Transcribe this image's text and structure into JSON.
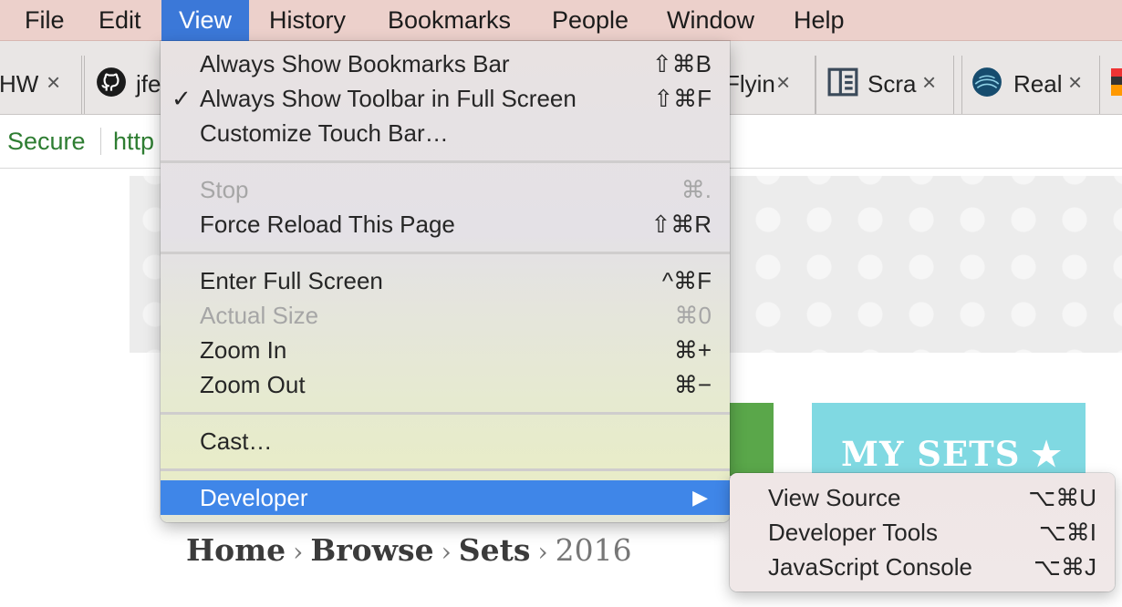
{
  "menubar": {
    "items": [
      {
        "label": "File"
      },
      {
        "label": "Edit"
      },
      {
        "label": "View"
      },
      {
        "label": "History"
      },
      {
        "label": "Bookmarks"
      },
      {
        "label": "People"
      },
      {
        "label": "Window"
      },
      {
        "label": "Help"
      }
    ],
    "active": "View"
  },
  "tabs": [
    {
      "title": "HW",
      "close": "×"
    },
    {
      "title": "jfe",
      "icon": "github-icon"
    },
    {
      "title": "Flyin",
      "close": "×"
    },
    {
      "title": "Scra",
      "close": "×",
      "icon": "book-icon"
    },
    {
      "title": "Real",
      "close": "×",
      "icon": "globe-icon"
    }
  ],
  "address": {
    "secure": "Secure",
    "url": "http"
  },
  "view_menu": {
    "groups": [
      [
        {
          "label": "Always Show Bookmarks Bar",
          "shortcut": "⇧⌘B",
          "checked": false,
          "enabled": true
        },
        {
          "label": "Always Show Toolbar in Full Screen",
          "shortcut": "⇧⌘F",
          "checked": true,
          "enabled": true
        },
        {
          "label": "Customize Touch Bar…",
          "shortcut": "",
          "checked": false,
          "enabled": true
        }
      ],
      [
        {
          "label": "Stop",
          "shortcut": "⌘.",
          "enabled": false
        },
        {
          "label": "Force Reload This Page",
          "shortcut": "⇧⌘R",
          "enabled": true
        }
      ],
      [
        {
          "label": "Enter Full Screen",
          "shortcut": "^⌘F",
          "enabled": true
        },
        {
          "label": "Actual Size",
          "shortcut": "⌘0",
          "enabled": false
        },
        {
          "label": "Zoom In",
          "shortcut": "⌘+",
          "enabled": true
        },
        {
          "label": "Zoom Out",
          "shortcut": "⌘−",
          "enabled": true
        }
      ],
      [
        {
          "label": "Cast…",
          "shortcut": "",
          "enabled": true
        }
      ],
      [
        {
          "label": "Developer",
          "submenu_arrow": "▶",
          "highlighted": true
        }
      ]
    ],
    "check_glyph": "✓"
  },
  "developer_submenu": [
    {
      "label": "View Source",
      "shortcut": "⌥⌘U"
    },
    {
      "label": "Developer Tools",
      "shortcut": "⌥⌘I"
    },
    {
      "label": "JavaScript Console",
      "shortcut": "⌥⌘J"
    }
  ],
  "page": {
    "mysets_label": "MY SETS",
    "mysets_star": "★",
    "breadcrumb": {
      "items": [
        "Home",
        "Browse",
        "Sets"
      ],
      "current": "2016",
      "separator": "›"
    }
  },
  "colors": {
    "menu_highlight": "#3f86e8",
    "menubar_active": "#3b78d8",
    "secure_green": "#2e7d32",
    "mysets_bg": "#80d9e2",
    "green_block": "#5aa74a"
  }
}
